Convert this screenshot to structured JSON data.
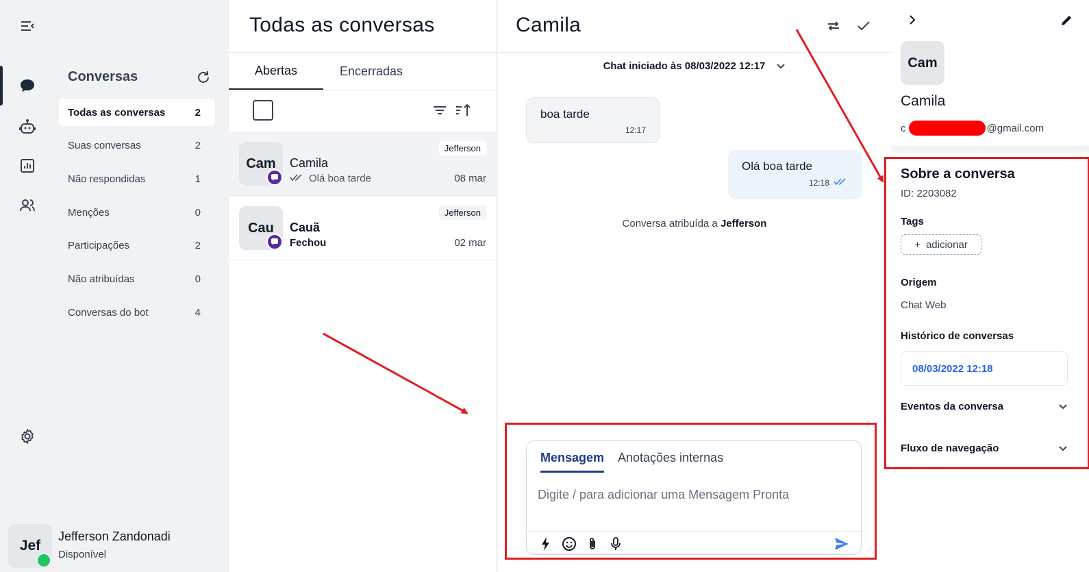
{
  "rail": {
    "items": [
      {
        "name": "collapse-menu-icon"
      },
      {
        "name": "chat-icon",
        "active": true
      },
      {
        "name": "bot-icon"
      },
      {
        "name": "reports-icon"
      },
      {
        "name": "contacts-icon"
      },
      {
        "name": "settings-icon"
      }
    ]
  },
  "menu": {
    "title": "Conversas",
    "items": [
      {
        "label": "Todas as conversas",
        "count": "2",
        "active": true
      },
      {
        "label": "Suas conversas",
        "count": "2"
      },
      {
        "label": "Não respondidas",
        "count": "1"
      },
      {
        "label": "Menções",
        "count": "0"
      },
      {
        "label": "Participações",
        "count": "2"
      },
      {
        "label": "Não atribuídas",
        "count": "0"
      },
      {
        "label": "Conversas do bot",
        "count": "4"
      }
    ]
  },
  "user": {
    "initials": "Jef",
    "name": "Jefferson Zandonadi",
    "status": "Disponível",
    "status_color": "#22c55e"
  },
  "list": {
    "title": "Todas as conversas",
    "tabs": [
      "Abertas",
      "Encerradas"
    ],
    "conversations": [
      {
        "initials": "Cam",
        "name": "Camila",
        "preview": "Olá boa tarde",
        "agent": "Jefferson",
        "date": "08 mar"
      },
      {
        "initials": "Cau",
        "name": "Cauã",
        "preview": "Fechou",
        "agent": "Jefferson",
        "date": "02 mar"
      }
    ]
  },
  "chat": {
    "title": "Camila",
    "started": "Chat iniciado às 08/03/2022 12:17",
    "messages": [
      {
        "text": "boa tarde",
        "time": "12:17",
        "direction": "in"
      },
      {
        "text": "Olá boa tarde",
        "time": "12:18",
        "direction": "out"
      }
    ],
    "assign_prefix": "Conversa atribuída a",
    "assign_agent": "Jefferson",
    "composer": {
      "tabs": [
        "Mensagem",
        "Anotações internas"
      ],
      "placeholder": "Digite / para adicionar uma Mensagem Pronta"
    }
  },
  "contact": {
    "initials": "Cam",
    "name": "Camila",
    "email_prefix": "c",
    "email_suffix": "@gmail.com"
  },
  "about": {
    "title": "Sobre a conversa",
    "id": "ID: 2203082",
    "tags_label": "Tags",
    "add_tag": "adicionar",
    "origin_label": "Origem",
    "origin_value": "Chat Web",
    "history_label": "Histórico de conversas",
    "history_item": "08/03/2022 12:18",
    "events_label": "Eventos da conversa",
    "flow_label": "Fluxo de navegação"
  },
  "colors": {
    "annotation_red": "#e11d24",
    "link_blue": "#2563eb",
    "send_blue": "#3b82f6",
    "channel_badge": "#5b2a9e"
  }
}
